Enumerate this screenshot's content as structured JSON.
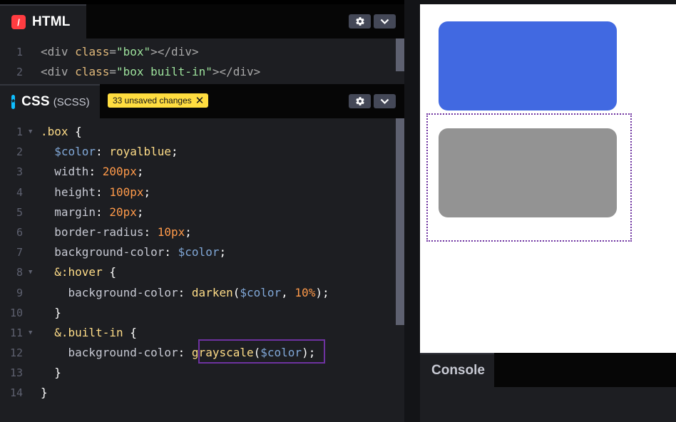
{
  "html_panel": {
    "title": "HTML",
    "icon": "html-icon",
    "icon_glyph": "/",
    "icon_color": "#ff3c41",
    "lines": [
      {
        "num": "1",
        "tokens": [
          {
            "t": "<div ",
            "c": "tag"
          },
          {
            "t": "class",
            "c": "attr"
          },
          {
            "t": "=",
            "c": "tag"
          },
          {
            "t": "\"box\"",
            "c": "str2"
          },
          {
            "t": "></div>",
            "c": "tag"
          }
        ]
      },
      {
        "num": "2",
        "tokens": [
          {
            "t": "<div ",
            "c": "tag"
          },
          {
            "t": "class",
            "c": "attr"
          },
          {
            "t": "=",
            "c": "tag"
          },
          {
            "t": "\"box built-in\"",
            "c": "str2"
          },
          {
            "t": "></div>",
            "c": "tag"
          }
        ]
      }
    ]
  },
  "css_panel": {
    "title": "CSS",
    "subtitle": "(SCSS)",
    "icon": "css-icon",
    "icon_glyph": "*",
    "icon_color": "#0ebeff",
    "badge": "33 unsaved changes",
    "badge_close": "✕",
    "lines": [
      {
        "num": "1",
        "fold": true,
        "tokens": [
          {
            "t": ".box ",
            "c": "kw"
          },
          {
            "t": "{",
            "c": "punct"
          }
        ]
      },
      {
        "num": "2",
        "tokens": [
          {
            "t": "  ",
            "c": "punct"
          },
          {
            "t": "$color",
            "c": "var"
          },
          {
            "t": ": ",
            "c": "punct"
          },
          {
            "t": "royalblue",
            "c": "kw"
          },
          {
            "t": ";",
            "c": "punct"
          }
        ]
      },
      {
        "num": "3",
        "tokens": [
          {
            "t": "  ",
            "c": "punct"
          },
          {
            "t": "width",
            "c": "prop"
          },
          {
            "t": ": ",
            "c": "punct"
          },
          {
            "t": "200px",
            "c": "num"
          },
          {
            "t": ";",
            "c": "punct"
          }
        ]
      },
      {
        "num": "4",
        "tokens": [
          {
            "t": "  ",
            "c": "punct"
          },
          {
            "t": "height",
            "c": "prop"
          },
          {
            "t": ": ",
            "c": "punct"
          },
          {
            "t": "100px",
            "c": "num"
          },
          {
            "t": ";",
            "c": "punct"
          }
        ]
      },
      {
        "num": "5",
        "tokens": [
          {
            "t": "  ",
            "c": "punct"
          },
          {
            "t": "margin",
            "c": "prop"
          },
          {
            "t": ": ",
            "c": "punct"
          },
          {
            "t": "20px",
            "c": "num"
          },
          {
            "t": ";",
            "c": "punct"
          }
        ]
      },
      {
        "num": "6",
        "tokens": [
          {
            "t": "  ",
            "c": "punct"
          },
          {
            "t": "border-radius",
            "c": "prop"
          },
          {
            "t": ": ",
            "c": "punct"
          },
          {
            "t": "10px",
            "c": "num"
          },
          {
            "t": ";",
            "c": "punct"
          }
        ]
      },
      {
        "num": "7",
        "tokens": [
          {
            "t": "  ",
            "c": "punct"
          },
          {
            "t": "background-color",
            "c": "prop"
          },
          {
            "t": ": ",
            "c": "punct"
          },
          {
            "t": "$color",
            "c": "var"
          },
          {
            "t": ";",
            "c": "punct"
          }
        ]
      },
      {
        "num": "8",
        "fold": true,
        "tokens": [
          {
            "t": "  ",
            "c": "punct"
          },
          {
            "t": "&:hover ",
            "c": "kw"
          },
          {
            "t": "{",
            "c": "punct"
          }
        ]
      },
      {
        "num": "9",
        "tokens": [
          {
            "t": "    ",
            "c": "punct"
          },
          {
            "t": "background-color",
            "c": "prop"
          },
          {
            "t": ": ",
            "c": "punct"
          },
          {
            "t": "darken",
            "c": "kw"
          },
          {
            "t": "(",
            "c": "punct"
          },
          {
            "t": "$color",
            "c": "var"
          },
          {
            "t": ", ",
            "c": "punct"
          },
          {
            "t": "10%",
            "c": "num"
          },
          {
            "t": ");",
            "c": "punct"
          }
        ]
      },
      {
        "num": "10",
        "tokens": [
          {
            "t": "  }",
            "c": "punct"
          }
        ]
      },
      {
        "num": "11",
        "fold": true,
        "tokens": [
          {
            "t": "  ",
            "c": "punct"
          },
          {
            "t": "&.built-in ",
            "c": "kw"
          },
          {
            "t": "{",
            "c": "punct"
          }
        ]
      },
      {
        "num": "12",
        "tokens": [
          {
            "t": "    ",
            "c": "punct"
          },
          {
            "t": "background-color",
            "c": "prop"
          },
          {
            "t": ": ",
            "c": "punct"
          },
          {
            "t": "grayscale",
            "c": "kw"
          },
          {
            "t": "(",
            "c": "punct"
          },
          {
            "t": "$color",
            "c": "var"
          },
          {
            "t": ")",
            "c": "punct"
          },
          {
            "t": ";",
            "c": "punct"
          }
        ]
      },
      {
        "num": "13",
        "tokens": [
          {
            "t": "  }",
            "c": "punct"
          }
        ]
      },
      {
        "num": "14",
        "tokens": [
          {
            "t": "}",
            "c": "punct"
          }
        ]
      }
    ]
  },
  "preview": {
    "box_color": "#4169e1",
    "builtin_color": "#939393",
    "highlight_color": "#6e32a0"
  },
  "console": {
    "title": "Console"
  },
  "icons": {
    "settings": "gear-icon",
    "collapse": "chevron-down-icon"
  }
}
